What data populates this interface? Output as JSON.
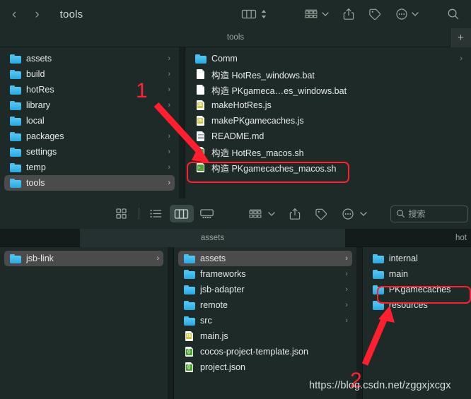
{
  "top_window": {
    "title": "tools",
    "nav": {
      "back": "‹",
      "forward": "›"
    },
    "tab_label": "tools",
    "new_tab_label": "+",
    "toolbar_icons": [
      "column-view-icon",
      "view-stepper-icon",
      "group-by-icon",
      "group-chevron-icon",
      "share-icon",
      "tag-icon",
      "more-actions-icon",
      "more-chevron-icon",
      "search-icon"
    ],
    "column1": {
      "items": [
        {
          "name": "assets",
          "icon": "folder-icon",
          "kind": "folder",
          "selected": false
        },
        {
          "name": "build",
          "icon": "folder-icon",
          "kind": "folder",
          "selected": false
        },
        {
          "name": "hotRes",
          "icon": "folder-icon",
          "kind": "folder",
          "selected": false
        },
        {
          "name": "library",
          "icon": "folder-icon",
          "kind": "folder",
          "selected": false
        },
        {
          "name": "local",
          "icon": "folder-icon",
          "kind": "folder",
          "selected": false
        },
        {
          "name": "packages",
          "icon": "folder-icon",
          "kind": "folder",
          "selected": false
        },
        {
          "name": "settings",
          "icon": "folder-icon",
          "kind": "folder",
          "selected": false
        },
        {
          "name": "temp",
          "icon": "folder-icon",
          "kind": "folder",
          "selected": false
        },
        {
          "name": "tools",
          "icon": "folder-icon",
          "kind": "folder",
          "selected": true
        }
      ]
    },
    "column2": {
      "items": [
        {
          "name": "Comm",
          "icon": "folder-icon",
          "kind": "folder"
        },
        {
          "name": "构造 HotRes_windows.bat",
          "icon": "document-icon",
          "kind": "doc"
        },
        {
          "name": "构造 PKgameca…es_windows.bat",
          "icon": "document-icon",
          "kind": "doc"
        },
        {
          "name": "makeHotRes.js",
          "icon": "js-file-icon",
          "kind": "js"
        },
        {
          "name": "makePKgamecaches.js",
          "icon": "js-file-icon",
          "kind": "js"
        },
        {
          "name": "README.md",
          "icon": "markdown-icon",
          "kind": "md"
        },
        {
          "name": "构造 HotRes_macos.sh",
          "icon": "shell-icon",
          "kind": "sh"
        },
        {
          "name": "构造 PKgamecaches_macos.sh",
          "icon": "shell-icon",
          "kind": "sh",
          "highlighted": true
        }
      ]
    }
  },
  "bottom_window": {
    "view_buttons": [
      {
        "icon": "icon-view-icon",
        "active": false
      },
      {
        "icon": "list-view-icon",
        "active": false
      },
      {
        "icon": "column-view-icon",
        "active": true
      },
      {
        "icon": "gallery-view-icon",
        "active": false
      }
    ],
    "toolbar_icons": [
      "group-by-icon",
      "group-chevron-icon",
      "share-icon",
      "tag-icon",
      "more-actions-icon",
      "more-chevron-icon"
    ],
    "search": {
      "placeholder": "搜索",
      "value": "",
      "icon": "search-icon"
    },
    "tabs": [
      {
        "label": "",
        "active": false
      },
      {
        "label": "assets",
        "active": true
      },
      {
        "label": "hot",
        "active": false
      }
    ],
    "column1": {
      "items": [
        {
          "name": "jsb-link",
          "icon": "folder-icon",
          "kind": "folder",
          "selected": true
        }
      ]
    },
    "column2": {
      "items": [
        {
          "name": "assets",
          "icon": "folder-icon",
          "kind": "folder",
          "selected": true
        },
        {
          "name": "frameworks",
          "icon": "folder-icon",
          "kind": "folder"
        },
        {
          "name": "jsb-adapter",
          "icon": "folder-icon",
          "kind": "folder"
        },
        {
          "name": "remote",
          "icon": "folder-icon",
          "kind": "folder"
        },
        {
          "name": "src",
          "icon": "folder-icon",
          "kind": "folder"
        },
        {
          "name": "main.js",
          "icon": "js-file-icon",
          "kind": "js"
        },
        {
          "name": "cocos-project-template.json",
          "icon": "json-icon",
          "kind": "json"
        },
        {
          "name": "project.json",
          "icon": "json-icon",
          "kind": "json"
        }
      ]
    },
    "column3": {
      "items": [
        {
          "name": "internal",
          "icon": "folder-icon",
          "kind": "folder"
        },
        {
          "name": "main",
          "icon": "folder-icon",
          "kind": "folder"
        },
        {
          "name": "PKgamecaches",
          "icon": "folder-icon",
          "kind": "folder",
          "highlighted": true
        },
        {
          "name": "resources",
          "icon": "folder-icon",
          "kind": "folder"
        }
      ]
    }
  },
  "annotations": {
    "step1": "1",
    "step2": "2",
    "highlight_color": "#ff1f2e",
    "watermark": "https://blog.csdn.net/zggxjxcgx"
  }
}
